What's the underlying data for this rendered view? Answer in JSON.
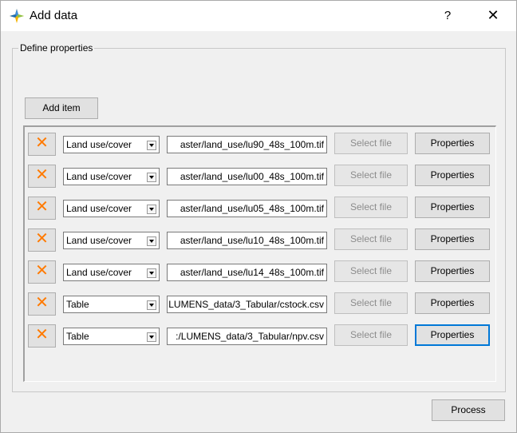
{
  "window": {
    "title": "Add data",
    "help_label": "?",
    "close_label": "✕"
  },
  "groupbox": {
    "title": "Define properties"
  },
  "toolbar": {
    "add_item_label": "Add item"
  },
  "rows": [
    {
      "delete_label": "✕",
      "type": "Land use/cover",
      "path": "aster/land_use/lu90_48s_100m.tif",
      "select_label": "Select file",
      "properties_label": "Properties"
    },
    {
      "delete_label": "✕",
      "type": "Land use/cover",
      "path": "aster/land_use/lu00_48s_100m.tif",
      "select_label": "Select file",
      "properties_label": "Properties"
    },
    {
      "delete_label": "✕",
      "type": "Land use/cover",
      "path": "aster/land_use/lu05_48s_100m.tif",
      "select_label": "Select file",
      "properties_label": "Properties"
    },
    {
      "delete_label": "✕",
      "type": "Land use/cover",
      "path": "aster/land_use/lu10_48s_100m.tif",
      "select_label": "Select file",
      "properties_label": "Properties"
    },
    {
      "delete_label": "✕",
      "type": "Land use/cover",
      "path": "aster/land_use/lu14_48s_100m.tif",
      "select_label": "Select file",
      "properties_label": "Properties"
    },
    {
      "delete_label": "✕",
      "type": "Table",
      "path": "LUMENS_data/3_Tabular/cstock.csv",
      "select_label": "Select file",
      "properties_label": "Properties"
    },
    {
      "delete_label": "✕",
      "type": "Table",
      "path": ":/LUMENS_data/3_Tabular/npv.csv",
      "select_label": "Select file",
      "properties_label": "Properties"
    }
  ],
  "footer": {
    "process_label": "Process"
  },
  "colors": {
    "delete_icon": "#ff7a00",
    "focus_border": "#0078d7"
  }
}
